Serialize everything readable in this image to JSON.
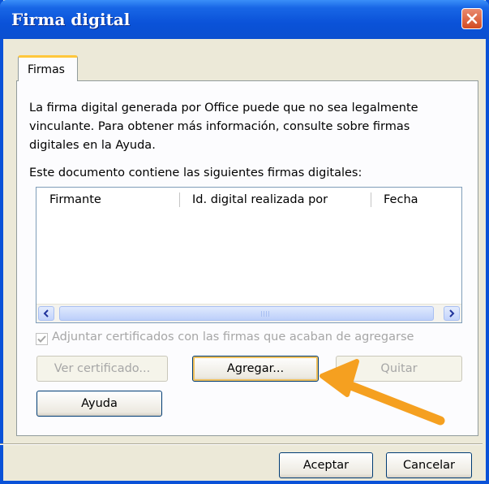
{
  "window": {
    "title": "Firma digital"
  },
  "tabs": [
    {
      "label": "Firmas"
    }
  ],
  "description": "La firma digital generada por Office puede que no sea legalmente vinculante. Para obtener más información, consulte sobre firmas digitales en la Ayuda.",
  "list": {
    "label": "Este documento contiene las siguientes firmas digitales:",
    "columns": [
      "Firmante",
      "Id. digital realizada por",
      "Fecha"
    ],
    "rows": []
  },
  "checkbox": {
    "label": "Adjuntar certificados con las firmas que acaban de agregarse",
    "checked": true,
    "enabled": false
  },
  "buttons": {
    "view_certificate": "Ver certificado...",
    "add": "Agregar...",
    "remove": "Quitar",
    "help": "Ayuda",
    "ok": "Aceptar",
    "cancel": "Cancelar"
  },
  "colors": {
    "titlebar": "#0a52d8",
    "annotation_arrow": "#f5a020",
    "tab_accent": "#ffc73c"
  },
  "icons": {
    "close": "close-icon",
    "checkmark": "check-icon",
    "scroll_left": "arrow-left-icon",
    "scroll_right": "arrow-right-icon"
  }
}
